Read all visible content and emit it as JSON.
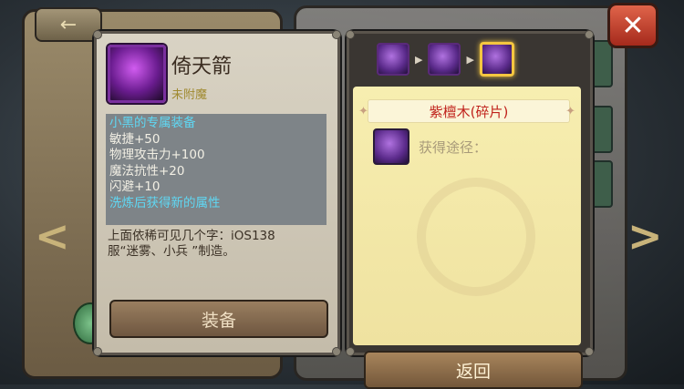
{
  "item": {
    "name": "倚天箭",
    "sub": "未附魔",
    "stats": [
      {
        "text": "小黑的专属装备",
        "color": "blue"
      },
      {
        "text": "敏捷+50",
        "color": "white"
      },
      {
        "text": "物理攻击力+100",
        "color": "white"
      },
      {
        "text": "魔法抗性+20",
        "color": "white"
      },
      {
        "text": "闪避+10",
        "color": "white"
      },
      {
        "text": "洗炼后获得新的属性",
        "color": "blue"
      }
    ],
    "desc_line1": "上面依稀可见几个字：iOS138",
    "desc_line2": "服“迷雾、小兵 ”制造。",
    "equip_label": "装备"
  },
  "source": {
    "title": "紫檀木(碎片)",
    "obtain_label": "获得途径：",
    "return_label": "返回"
  },
  "background": {
    "nav_left": "<",
    "nav_right": ">",
    "back_arrow": "←",
    "close_symbol": "✕"
  }
}
